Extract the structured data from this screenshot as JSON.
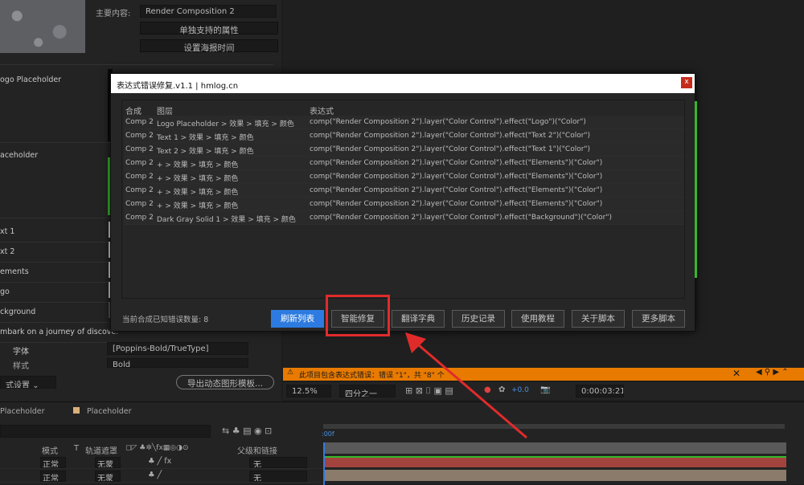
{
  "left_panel": {
    "main_content_label": "主要内容:",
    "main_content_value": "Render Composition 2",
    "btn_standalone_props": "单独支持的属性",
    "btn_set_poster_time": "设置海报时间",
    "layers": [
      "ogo Placeholder",
      "aceholder",
      "xt 1",
      "xt 2",
      "ements",
      "go",
      "ckground",
      "mbark on a journey of discove..."
    ],
    "font_label": "字体",
    "font_value": "[Poppins-Bold/TrueType]",
    "style_label": "样式",
    "style_value": "Bold",
    "format_settings": "式设置",
    "export_mogrt": "导出动态图形模板..."
  },
  "dialog": {
    "title": "表达式错误修复.v1.1 | hmlog.cn",
    "close": "x",
    "columns": [
      "合成",
      "图层",
      "表达式"
    ],
    "rows": [
      {
        "comp": "Comp 2",
        "layer": "Logo Placeholder > 效果 > 填充 > 颜色",
        "expr": "comp(\"Render Composition 2\").layer(\"Color Control\").effect(\"Logo\")(\"Color\")"
      },
      {
        "comp": "Comp 2",
        "layer": "Text 1 > 效果 > 填充 > 颜色",
        "expr": "comp(\"Render Composition 2\").layer(\"Color Control\").effect(\"Text 2\")(\"Color\")"
      },
      {
        "comp": "Comp 2",
        "layer": "Text 2 > 效果 > 填充 > 颜色",
        "expr": "comp(\"Render Composition 2\").layer(\"Color Control\").effect(\"Text 1\")(\"Color\")"
      },
      {
        "comp": "Comp 2",
        "layer": "+ > 效果 > 填充 > 颜色",
        "expr": "comp(\"Render Composition 2\").layer(\"Color Control\").effect(\"Elements\")(\"Color\")"
      },
      {
        "comp": "Comp 2",
        "layer": "+ > 效果 > 填充 > 颜色",
        "expr": "comp(\"Render Composition 2\").layer(\"Color Control\").effect(\"Elements\")(\"Color\")"
      },
      {
        "comp": "Comp 2",
        "layer": "+ > 效果 > 填充 > 颜色",
        "expr": "comp(\"Render Composition 2\").layer(\"Color Control\").effect(\"Elements\")(\"Color\")"
      },
      {
        "comp": "Comp 2",
        "layer": "+ > 效果 > 填充 > 颜色",
        "expr": "comp(\"Render Composition 2\").layer(\"Color Control\").effect(\"Elements\")(\"Color\")"
      },
      {
        "comp": "Comp 2",
        "layer": "Dark Gray Solid 1 > 效果 > 填充 > 颜色",
        "expr": "comp(\"Render Composition 2\").layer(\"Color Control\").effect(\"Background\")(\"Color\")"
      }
    ],
    "error_count_text": "当前合成已知错误数量: 8",
    "buttons": {
      "refresh": "刷新列表",
      "smart_fix": "智能修复",
      "translate": "翻译字典",
      "history": "历史记录",
      "tutorial": "使用教程",
      "about": "关于脚本",
      "more": "更多脚本"
    }
  },
  "viewer": {
    "warning_text": "此项目包含表达式错误：错误 \"1\"，共 \"8\" 个",
    "zoom": "12.5%",
    "resolution": "四分之一",
    "exposure": "+0.0",
    "timecode": "0:00:03:21"
  },
  "timeline": {
    "placeholder_left": "Placeholder",
    "placeholder_right": "Placeholder",
    "col_mode": "模式",
    "col_t": "T",
    "col_track_matte": "轨道遮罩",
    "col_parent": "父级和链接",
    "frame_label": ":00f",
    "rows": [
      {
        "mode": "正常",
        "matte": "无蒙",
        "parent": "无"
      },
      {
        "mode": "正常",
        "matte": "无蒙",
        "parent": "无"
      }
    ]
  },
  "colors": {
    "accent_blue": "#2d7be0",
    "warning_orange": "#e87a00",
    "highlight_red": "#e02b2b",
    "track_red": "#a3433e"
  }
}
